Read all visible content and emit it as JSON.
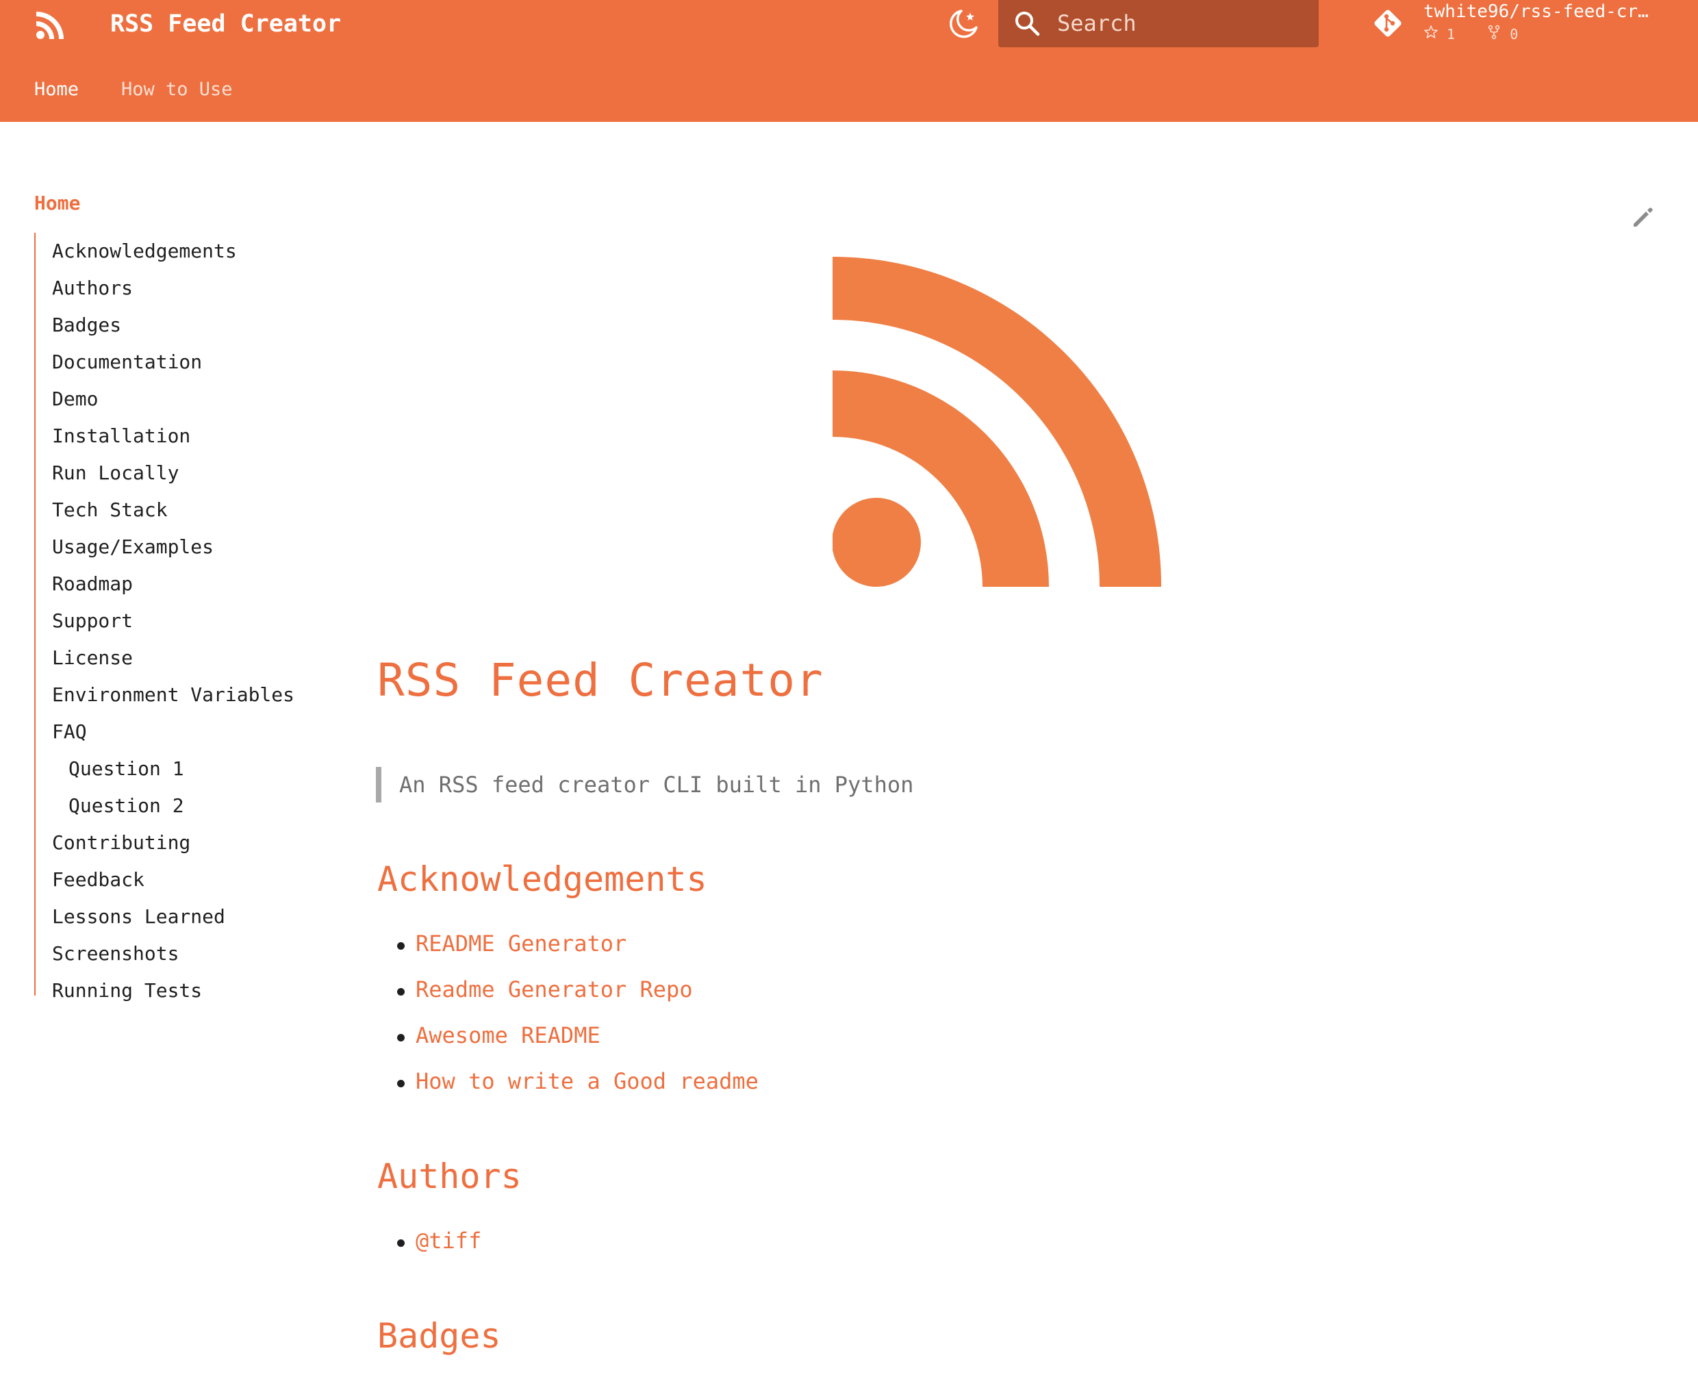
{
  "colors": {
    "accent": "#ee6f3f",
    "search_bg": "#af4f2d",
    "text": "#1f1f1f",
    "muted": "#6f6f6f"
  },
  "header": {
    "logo_icon": "rss-icon",
    "title": "RSS Feed Creator",
    "theme_toggle_icon": "theme-toggle-icon",
    "search": {
      "placeholder": "Search",
      "icon": "search-icon"
    },
    "repo": {
      "icon": "git-icon",
      "name": "twhite96/rss-feed-cr…",
      "stars": "1",
      "forks": "0"
    },
    "tabs": [
      {
        "label": "Home",
        "active": true
      },
      {
        "label": "How to Use",
        "active": false
      }
    ]
  },
  "sidebar": {
    "title": "Home",
    "items": [
      {
        "label": "Acknowledgements"
      },
      {
        "label": "Authors"
      },
      {
        "label": "Badges"
      },
      {
        "label": "Documentation"
      },
      {
        "label": "Demo"
      },
      {
        "label": "Installation"
      },
      {
        "label": "Run Locally"
      },
      {
        "label": "Tech Stack"
      },
      {
        "label": "Usage/Examples"
      },
      {
        "label": "Roadmap"
      },
      {
        "label": "Support"
      },
      {
        "label": "License"
      },
      {
        "label": "Environment Variables"
      },
      {
        "label": "FAQ"
      },
      {
        "label": "Question 1"
      },
      {
        "label": "Question 2"
      },
      {
        "label": "Contributing"
      },
      {
        "label": "Feedback"
      },
      {
        "label": "Lessons Learned"
      },
      {
        "label": "Screenshots"
      },
      {
        "label": "Running Tests"
      }
    ]
  },
  "main": {
    "edit_icon": "edit-icon",
    "hero_icon": "rss-icon",
    "title": "RSS Feed Creator",
    "tagline": "An RSS feed creator CLI built in Python",
    "sections": [
      {
        "heading": "Acknowledgements",
        "links": [
          "README Generator",
          "Readme Generator Repo",
          "Awesome README",
          "How to write a Good readme"
        ]
      },
      {
        "heading": "Authors",
        "links": [
          "@tiff"
        ]
      },
      {
        "heading": "Badges",
        "links": []
      }
    ]
  }
}
